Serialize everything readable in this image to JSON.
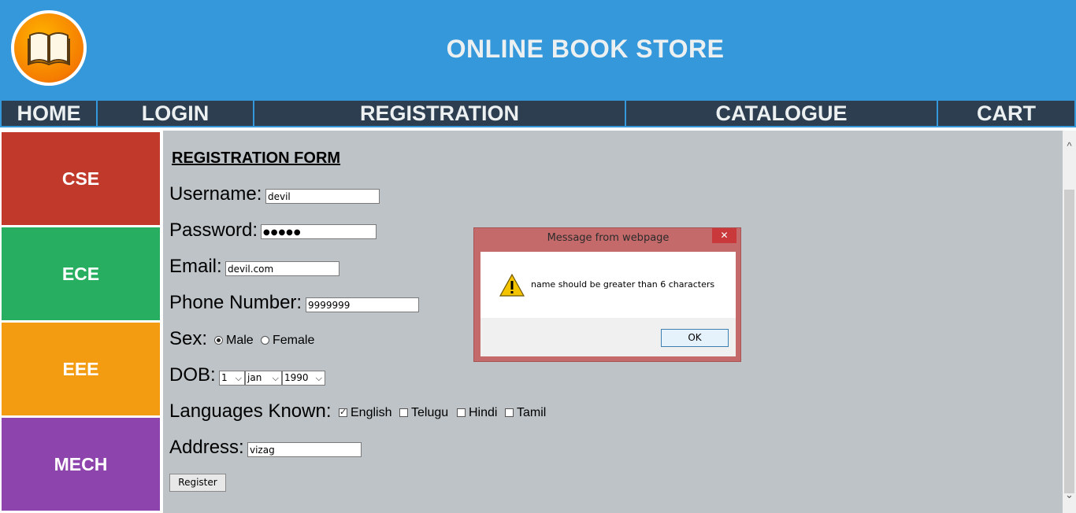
{
  "header": {
    "title": "ONLINE BOOK STORE",
    "logo_icon": "open-book-icon"
  },
  "nav": {
    "items": [
      "HOME",
      "LOGIN",
      "REGISTRATION",
      "CATALOGUE",
      "CART"
    ]
  },
  "sidebar": {
    "items": [
      {
        "label": "CSE",
        "color": "#c0392b"
      },
      {
        "label": "ECE",
        "color": "#27ae60"
      },
      {
        "label": "EEE",
        "color": "#f39c12"
      },
      {
        "label": "MECH",
        "color": "#8e44ad"
      }
    ]
  },
  "form": {
    "title": "REGISTRATION FORM",
    "username": {
      "label": "Username:",
      "value": "devil"
    },
    "password": {
      "label": "Password:",
      "value": "●●●●●"
    },
    "email": {
      "label": "Email:",
      "value": "devil.com"
    },
    "phone": {
      "label": "Phone Number:",
      "value": "9999999"
    },
    "sex": {
      "label": "Sex:",
      "options": [
        "Male",
        "Female"
      ],
      "selected": "Male"
    },
    "dob": {
      "label": "DOB:",
      "day": "1",
      "month": "jan",
      "year": "1990"
    },
    "languages": {
      "label": "Languages Known:",
      "options": [
        "English",
        "Telugu",
        "Hindi",
        "Tamil"
      ],
      "checked": [
        "English"
      ]
    },
    "address": {
      "label": "Address:",
      "value": "vizag"
    },
    "submit_label": "Register"
  },
  "dialog": {
    "title": "Message from webpage",
    "close_glyph": "✕",
    "message": "name should be  greater than 6 characters",
    "ok_label": "OK",
    "icon": "warning-icon"
  },
  "colors": {
    "header_bg": "#3598db",
    "nav_bg": "#2c3e50",
    "main_bg": "#bdc3c7",
    "text_light": "#ecf0f1"
  }
}
